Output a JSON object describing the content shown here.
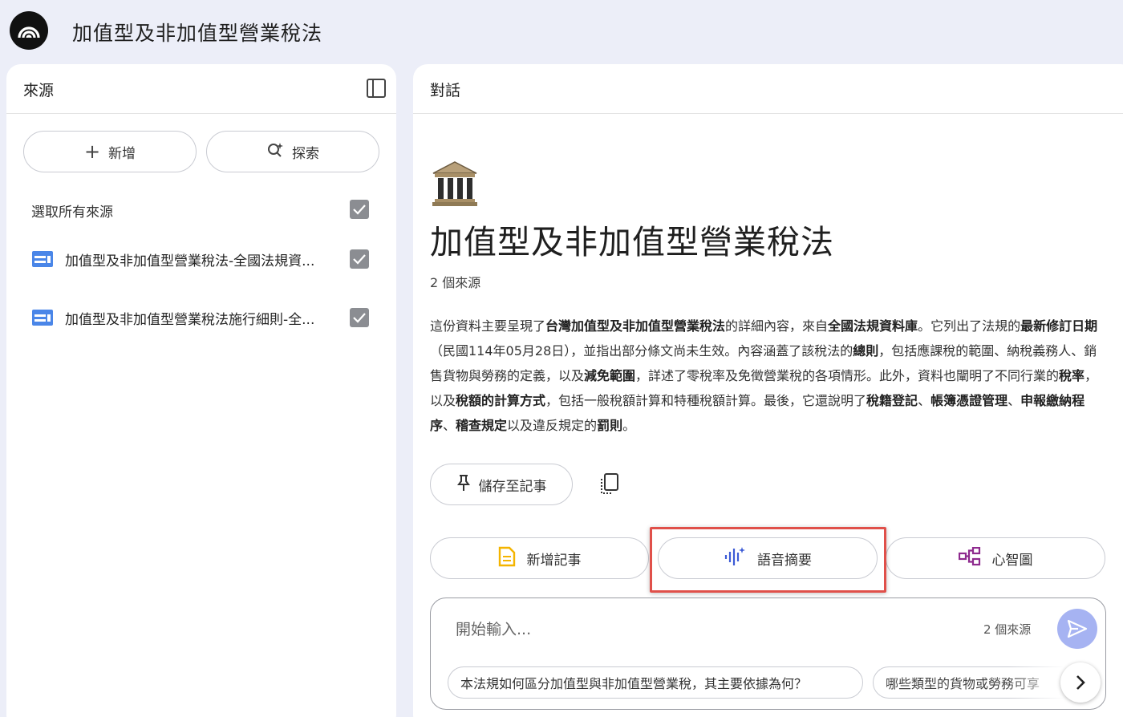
{
  "header": {
    "app_title": "加值型及非加值型營業稅法",
    "logo_icon": "notebooklm-logo-icon"
  },
  "sources_panel": {
    "title": "來源",
    "collapse_icon": "sidebar-collapse-icon",
    "add_label": "新增",
    "discover_label": "探索",
    "select_all_label": "選取所有來源",
    "select_all_checked": true,
    "items": [
      {
        "label": "加值型及非加值型營業稅法-全國法規資...",
        "icon": "web-source-icon",
        "checked": true
      },
      {
        "label": "加值型及非加值型營業稅法施行細則-全...",
        "icon": "web-source-icon",
        "checked": true
      }
    ]
  },
  "chat_panel": {
    "title": "對話",
    "emoji_icon": "classical-building-icon",
    "notebook_title": "加值型及非加值型營業稅法",
    "source_count": "2 個來源",
    "summary_segments": [
      {
        "text": "這份資料主要呈現了",
        "bold": false
      },
      {
        "text": "台灣加值型及非加值型營業稅法",
        "bold": true
      },
      {
        "text": "的詳細內容，來自",
        "bold": false
      },
      {
        "text": "全國法規資料庫",
        "bold": true
      },
      {
        "text": "。它列出了法規的",
        "bold": false
      },
      {
        "text": "最新修訂日期",
        "bold": true
      },
      {
        "text": "（民國114年05月28日），並指出部分條文尚未生效。內容涵蓋了該稅法的",
        "bold": false
      },
      {
        "text": "總則",
        "bold": true
      },
      {
        "text": "，包括應課稅的範圍、納稅義務人、銷售貨物與勞務的定義，以及",
        "bold": false
      },
      {
        "text": "減免範圍",
        "bold": true
      },
      {
        "text": "，詳述了零稅率及免徵營業稅的各項情形。此外，資料也闡明了不同行業的",
        "bold": false
      },
      {
        "text": "稅率",
        "bold": true
      },
      {
        "text": "，以及",
        "bold": false
      },
      {
        "text": "稅額的計算方式",
        "bold": true
      },
      {
        "text": "，包括一般稅額計算和特種稅額計算。最後，它還說明了",
        "bold": false
      },
      {
        "text": "稅籍登記",
        "bold": true
      },
      {
        "text": "、",
        "bold": false
      },
      {
        "text": "帳簿憑證管理",
        "bold": true
      },
      {
        "text": "、",
        "bold": false
      },
      {
        "text": "申報繳納程序",
        "bold": true
      },
      {
        "text": "、",
        "bold": false
      },
      {
        "text": "稽查規定",
        "bold": true
      },
      {
        "text": "以及違反規定的",
        "bold": false
      },
      {
        "text": "罰則",
        "bold": true
      },
      {
        "text": "。",
        "bold": false
      }
    ],
    "save_note_label": "儲存至記事",
    "copy_icon": "copy-icon",
    "actions": {
      "note_label": "新增記事",
      "audio_label": "語音摘要",
      "mindmap_label": "心智圖"
    },
    "input": {
      "placeholder": "開始輸入...",
      "source_count": "2 個來源"
    },
    "suggestions": [
      "本法規如何區分加值型與非加值型營業稅，其主要依據為何？",
      "哪些類型的貨物或勞務可享"
    ]
  },
  "colors": {
    "background": "#eceef8",
    "panel": "#ffffff",
    "highlight_border": "#e0504a",
    "send_button": "#a6b3f2",
    "source_icon": "#4a86e8",
    "note_icon": "#f4b400",
    "audio_icon": "#3c5bd6",
    "mindmap_icon": "#8e2a8e"
  }
}
